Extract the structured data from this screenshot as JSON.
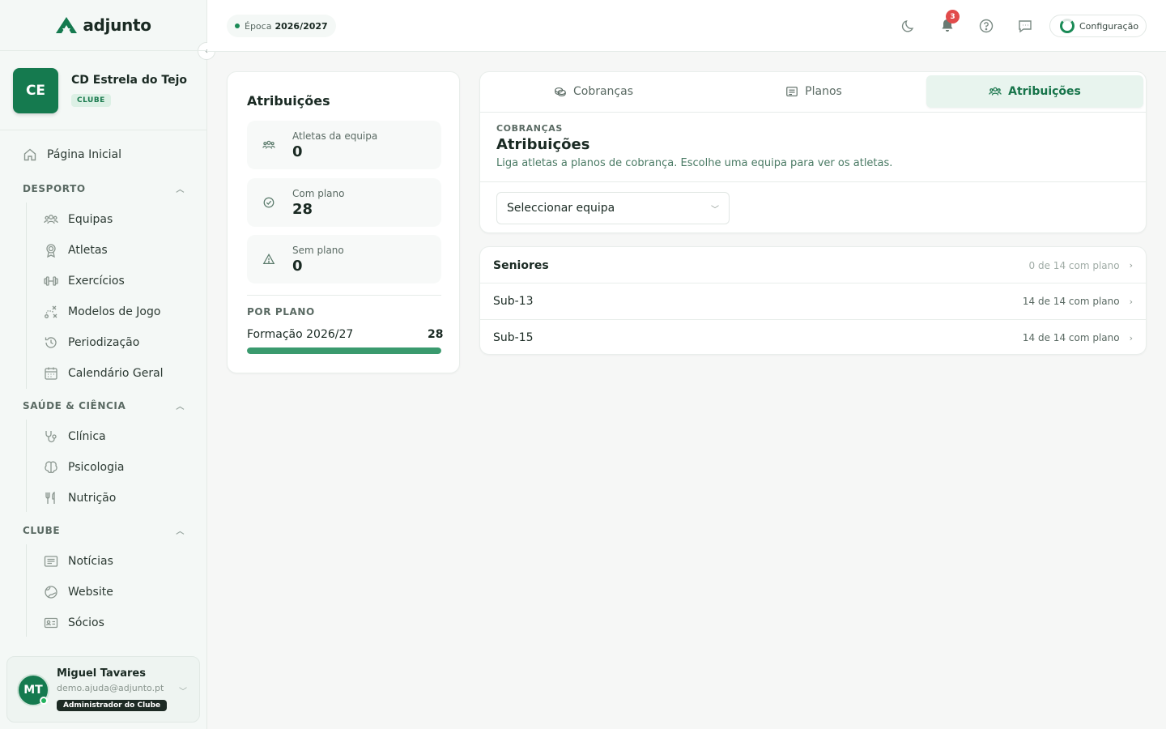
{
  "app": {
    "brand": "adjunto"
  },
  "club": {
    "initials": "CE",
    "name": "CD Estrela do Tejo",
    "badge": "CLUBE"
  },
  "sidebar": {
    "home": "Página Inicial",
    "sections": [
      {
        "title": "DESPORTO",
        "items": [
          "Equipas",
          "Atletas",
          "Exercícios",
          "Modelos de Jogo",
          "Periodização",
          "Calendário Geral"
        ]
      },
      {
        "title": "SAÚDE & CIÊNCIA",
        "items": [
          "Clínica",
          "Psicologia",
          "Nutrição"
        ]
      },
      {
        "title": "CLUBE",
        "items": [
          "Notícias",
          "Website",
          "Sócios"
        ]
      }
    ]
  },
  "user": {
    "initials": "MT",
    "name": "Miguel Tavares",
    "email": "demo.ajuda@adjunto.pt",
    "role": "Administrador do Clube"
  },
  "topbar": {
    "season_label": "Época",
    "season_value": "2026/2027",
    "notifications": "3",
    "config": "Configuração"
  },
  "stats": {
    "title": "Atribuições",
    "items": [
      {
        "label": "Atletas da equipa",
        "value": "0",
        "icon": "users-icon"
      },
      {
        "label": "Com plano",
        "value": "28",
        "icon": "check-circle-icon"
      },
      {
        "label": "Sem plano",
        "value": "0",
        "icon": "warning-icon"
      }
    ],
    "por_plano_title": "POR PLANO",
    "plans": [
      {
        "name": "Formação 2026/27",
        "count": "28",
        "fraction": 1.0
      }
    ]
  },
  "tabs": [
    {
      "label": "Cobranças",
      "icon": "coins-icon"
    },
    {
      "label": "Planos",
      "icon": "list-icon"
    },
    {
      "label": "Atribuições",
      "icon": "users-icon",
      "active": true
    }
  ],
  "main": {
    "eyebrow": "COBRANÇAS",
    "title": "Atribuições",
    "description": "Liga atletas a planos de cobrança. Escolhe uma equipa para ver os atletas.",
    "select_placeholder": "Seleccionar equipa"
  },
  "teams": [
    {
      "name": "Seniores",
      "status": "0 de 14 com plano"
    },
    {
      "name": "Sub-13",
      "status": "14 de 14 com plano"
    },
    {
      "name": "Sub-15",
      "status": "14 de 14 com plano"
    }
  ],
  "colors": {
    "brand": "#157a4f",
    "accent_bg": "#e8f4ee",
    "badge_red": "#e14b4b"
  }
}
